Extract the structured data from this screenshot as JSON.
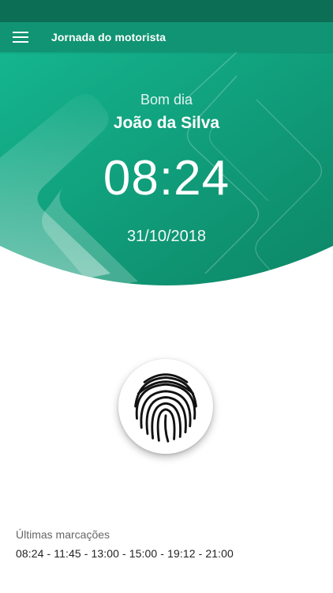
{
  "app_bar": {
    "title": "Jornada do motorista",
    "menu_icon": "hamburger-menu-icon"
  },
  "hero": {
    "greeting": "Bom dia",
    "user_name": "João da Silva",
    "time": "08:24",
    "date": "31/10/2018"
  },
  "fingerprint": {
    "icon": "fingerprint-icon"
  },
  "marks": {
    "label": "Últimas marcações",
    "times": "08:24 - 11:45 - 13:00 - 15:00 - 19:12 - 21:00"
  },
  "colors": {
    "status_bar": "#0c6e55",
    "app_bar": "#119473",
    "gradient_start": "#13b48e",
    "gradient_end": "#0e8a68",
    "background": "#ffffff"
  }
}
